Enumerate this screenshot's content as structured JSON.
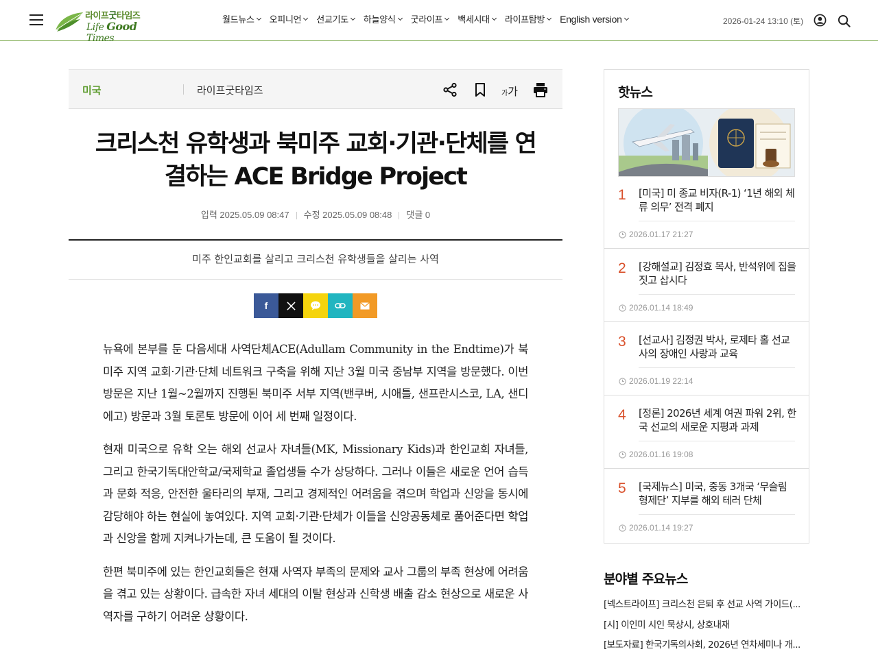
{
  "header": {
    "logo_kr_1": "라이프",
    "logo_kr_2": "굿",
    "logo_kr_3": "타임즈",
    "logo_en_1": "Life ",
    "logo_en_2": "Good",
    "logo_en_3": " Times",
    "nav": [
      {
        "label": "월드뉴스"
      },
      {
        "label": "오피니언"
      },
      {
        "label": "선교기도"
      },
      {
        "label": "하늘양식"
      },
      {
        "label": "굿라이프"
      },
      {
        "label": "백세시대"
      },
      {
        "label": "라이프탐방"
      },
      {
        "label": "English version"
      }
    ],
    "datetime": "2026-01-24 13:10 (토)",
    "icons": [
      "menu-icon",
      "user-icon",
      "search-icon"
    ]
  },
  "article": {
    "category": "미국",
    "source": "라이프굿타임즈",
    "font_label_small": "가",
    "font_label_big": "가",
    "headline_line1": "크리스천 유학생과 북미주 교회·기관·단체를 연",
    "headline_line2": "결하는 ACE Bridge Project",
    "published": "입력 2025.05.09 08:47",
    "modified": "수정 2025.05.09 08:48",
    "comments": "댓글 0",
    "subtitle": "미주 한인교회를 살리고 크리스천 유학생들을 살리는 사역",
    "share": {
      "facebook": "f"
    },
    "paragraphs": [
      "뉴욕에 본부를 둔 다음세대 사역단체ACE(Adullam Community in the Endtime)가 북미주 지역 교회·기관·단체 네트워크 구축을 위해 지난 3월 미국 중남부 지역을 방문했다. 이번 방문은 지난 1월~2월까지 진행된 북미주 서부 지역(밴쿠버, 시애틀, 샌프란시스코, LA, 샌디에고) 방문과 3월 토론토 방문에 이어 세 번째 일정이다.",
      "현재 미국으로 유학 오는 해외 선교사 자녀들(MK, Missionary Kids)과 한인교회 자녀들, 그리고 한국기독대안학교/국제학교 졸업생들 수가 상당하다. 그러나 이들은 새로운 언어 습득과 문화 적응, 안전한 울타리의 부재, 그리고 경제적인 어려움을 겪으며 학업과 신앙을 동시에 감당해야 하는 현실에 놓여있다. 지역 교회·기관·단체가 이들을 신앙공동체로 품어준다면 학업과 신앙을 함께 지켜나가는데, 큰 도움이 될 것이다.",
      "한편 북미주에 있는 한인교회들은 현재 사역자 부족의 문제와 교사 그룹의 부족 현상에 어려움을 겪고 있는 상황이다. 급속한 자녀 세대의 이탈 현상과 신학생 배출 감소 현상으로 새로운 사역자를 구하기 어려운 상황이다."
    ]
  },
  "sidebar": {
    "hot_title": "핫뉴스",
    "hot": [
      {
        "num": "1",
        "title": "[미국] 미 종교 비자(R-1) ‘1년 해외 체류 의무’ 전격 폐지",
        "time": "2026.01.17 21:27"
      },
      {
        "num": "2",
        "title": "[강해설교] 김정효 목사, 반석위에 집을 짓고 삽시다",
        "time": "2026.01.14 18:49"
      },
      {
        "num": "3",
        "title": "[선교사] 김정권 박사, 로제타 홀 선교사의 장애인 사랑과 교육",
        "time": "2026.01.19 22:14"
      },
      {
        "num": "4",
        "title": "[정론] 2026년 세계 여권 파워 2위, 한국 선교의 새로운 지평과 과제",
        "time": "2026.01.16 19:08"
      },
      {
        "num": "5",
        "title": "[국제뉴스] 미국, 중동 3개국 ‘무슬림 형제단’ 지부를 해외 테러 단체",
        "time": "2026.01.14 19:27"
      }
    ],
    "section_title": "분야별 주요뉴스",
    "section_items": [
      "[넥스트라이프] 크리스천 은퇴 후 선교 사역 가이드(...",
      "[시] 이인미 시인 묵상시, 상호내재",
      "[보도자료] 한국기독의사회, 2026년 연차세미나 개..."
    ]
  }
}
